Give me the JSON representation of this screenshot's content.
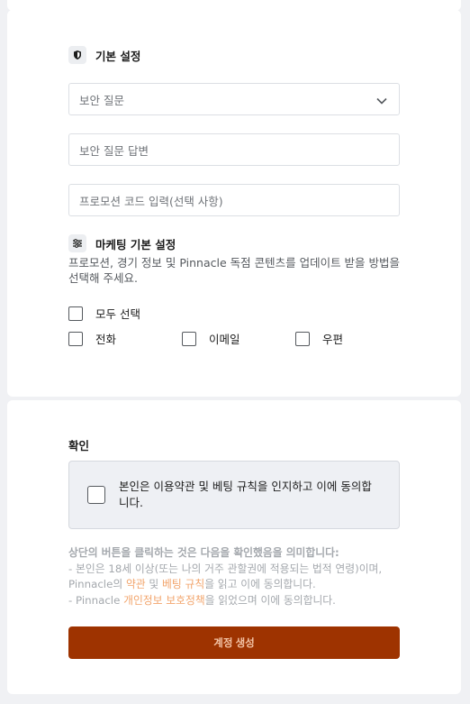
{
  "basic_settings": {
    "title": "기본 설정",
    "icon": "shield-icon",
    "security_question": {
      "placeholder": "보안 질문"
    },
    "security_answer": {
      "placeholder": "보안 질문 답변"
    },
    "promo_code": {
      "placeholder": "프로모션 코드 입력(선택 사항)"
    }
  },
  "marketing": {
    "title": "마케팅 기본 설정",
    "icon": "sliders-icon",
    "description": "프로모션, 경기 정보 및 Pinnacle 독점 콘텐츠를 업데이트 받을 방법을 선택해 주세요.",
    "select_all": "모두 선택",
    "options": [
      "전화",
      "이메일",
      "우편"
    ]
  },
  "confirm": {
    "title": "확인",
    "consent_text": "본인은 이용약관 및 베팅 규칙을 인지하고 이에 동의합니다.",
    "legal": {
      "heading": "상단의 버튼을 클릭하는 것은 다음을 확인했음을 의미합니다:",
      "line1": "- 본인은 18세 이상(또는 나의 거주 관할권에 적용되는 법적 연령)이며, Pinnacle의 ",
      "terms_link": "약관",
      "and": " 및 ",
      "rules_link": "베팅 규칙",
      "line1_end": "을 읽고 이에 동의합니다.",
      "line2": "- Pinnacle ",
      "privacy_link": "개인정보 보호정책",
      "line2_end": "을 읽었으며 이에 동의합니다."
    },
    "button": "계정 생성"
  },
  "colors": {
    "button_bg": "#9e3300",
    "link": "#f2a46b",
    "background": "#f0f1f4"
  }
}
